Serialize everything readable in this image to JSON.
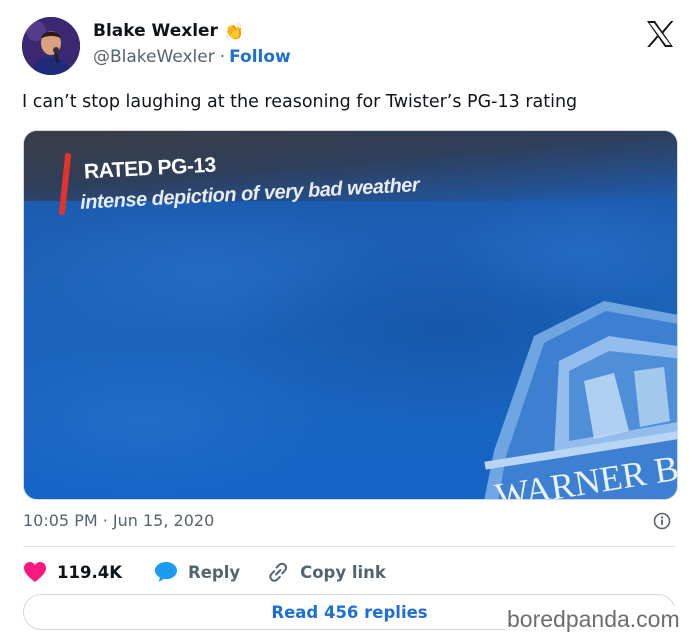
{
  "author": {
    "name": "Blake Wexler",
    "emoji": "👏",
    "handle": "@BlakeWexler",
    "separator": "·",
    "follow_label": "Follow"
  },
  "tweet": {
    "text": "I can’t stop laughing at the reasoning for Twister’s PG-13 rating",
    "timestamp": "10:05 PM · Jun 15, 2020"
  },
  "media": {
    "rating_title": "RATED PG-13",
    "rating_description": "intense depiction of very bad weather",
    "logo_text": "WARNER B"
  },
  "actions": {
    "like_count": "119.4K",
    "reply_label": "Reply",
    "copy_link_label": "Copy link"
  },
  "read_replies_label": "Read 456 replies",
  "watermark": "boredpanda.com",
  "colors": {
    "accent": "#1d6fd6",
    "like": "#f91880",
    "reply": "#1d9bf0",
    "secondary_text": "#536471"
  }
}
